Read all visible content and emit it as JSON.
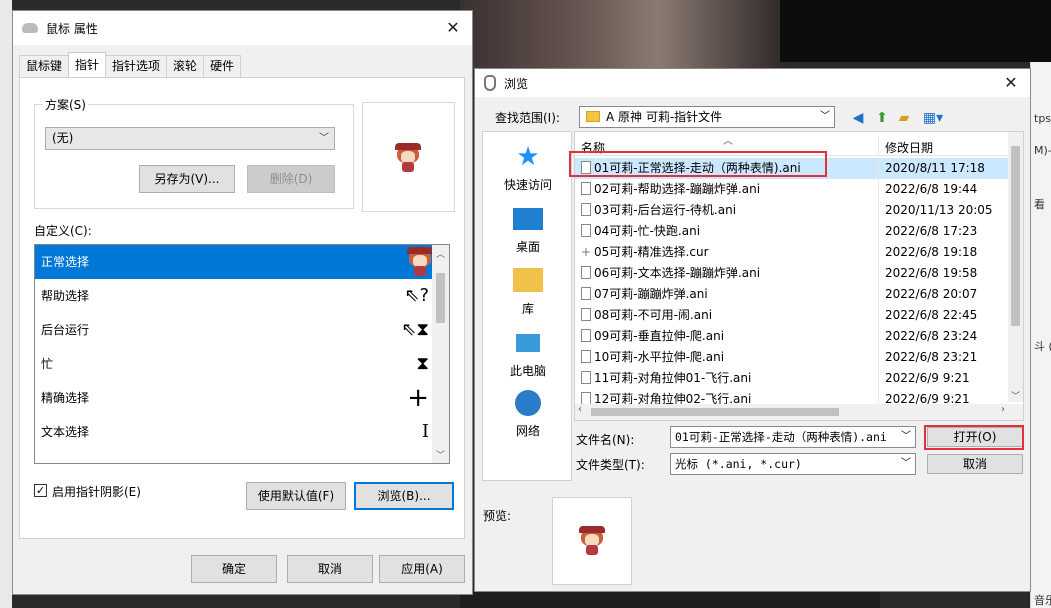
{
  "mouse_props": {
    "title": "鼠标 属性",
    "tabs": [
      "鼠标键",
      "指针",
      "指针选项",
      "滚轮",
      "硬件"
    ],
    "scheme_label": "方案(S)",
    "scheme_value": "(无)",
    "save_as": "另存为(V)...",
    "delete": "删除(D)",
    "customize_label": "自定义(C):",
    "cursor_items": [
      {
        "label": "正常选择",
        "icon": "sprite"
      },
      {
        "label": "帮助选择",
        "icon": "⇖?"
      },
      {
        "label": "后台运行",
        "icon": "⇖⧗"
      },
      {
        "label": "忙",
        "icon": "⧗"
      },
      {
        "label": "精确选择",
        "icon": "+"
      },
      {
        "label": "文本选择",
        "icon": "I"
      }
    ],
    "shadow_checkbox": "启用指针阴影(E)",
    "use_default": "使用默认值(F)",
    "browse": "浏览(B)...",
    "ok": "确定",
    "cancel": "取消",
    "apply": "应用(A)"
  },
  "browse": {
    "title": "浏览",
    "look_in_label": "查找范围(I):",
    "look_in_value": "A 原神 可莉-指针文件",
    "places": [
      "快速访问",
      "桌面",
      "库",
      "此电脑",
      "网络"
    ],
    "col_name": "名称",
    "col_date": "修改日期",
    "files": [
      {
        "name": "01可莉-正常选择-走动（两种表情).ani",
        "date": "2020/8/11 17:18",
        "type": "doc"
      },
      {
        "name": "02可莉-帮助选择-蹦蹦炸弹.ani",
        "date": "2022/6/8 19:44",
        "type": "doc"
      },
      {
        "name": "03可莉-后台运行-待机.ani",
        "date": "2020/11/13 20:05",
        "type": "doc"
      },
      {
        "name": "04可莉-忙-快跑.ani",
        "date": "2022/6/8 17:23",
        "type": "doc"
      },
      {
        "name": "05可莉-精准选择.cur",
        "date": "2022/6/8 19:18",
        "type": "cur"
      },
      {
        "name": "06可莉-文本选择-蹦蹦炸弹.ani",
        "date": "2022/6/8 19:58",
        "type": "doc"
      },
      {
        "name": "07可莉-蹦蹦炸弹.ani",
        "date": "2022/6/8 20:07",
        "type": "doc"
      },
      {
        "name": "08可莉-不可用-闹.ani",
        "date": "2022/6/8 22:45",
        "type": "doc"
      },
      {
        "name": "09可莉-垂直拉伸-爬.ani",
        "date": "2022/6/8 23:24",
        "type": "doc"
      },
      {
        "name": "10可莉-水平拉伸-爬.ani",
        "date": "2022/6/8 23:21",
        "type": "doc"
      },
      {
        "name": "11可莉-对角拉伸01-飞行.ani",
        "date": "2022/6/9 9:21",
        "type": "doc"
      },
      {
        "name": "12可莉-对角拉伸02-飞行.ani",
        "date": "2022/6/9 9:21",
        "type": "doc"
      }
    ],
    "filename_label": "文件名(N):",
    "filename_value": "01可莉-正常选择-走动（两种表情).ani",
    "filetype_label": "文件类型(T):",
    "filetype_value": "光标 (*.ani, *.cur)",
    "open": "打开(O)",
    "cancel": "取消",
    "preview_label": "预览:"
  },
  "background": {
    "right_snippets": [
      "tps:",
      "M)-I",
      "看",
      "斗 (E",
      "音乐"
    ]
  },
  "colors": {
    "accent": "#0078d7",
    "highlight_box": "#e0323c",
    "selected_row": "#cce8ff"
  }
}
